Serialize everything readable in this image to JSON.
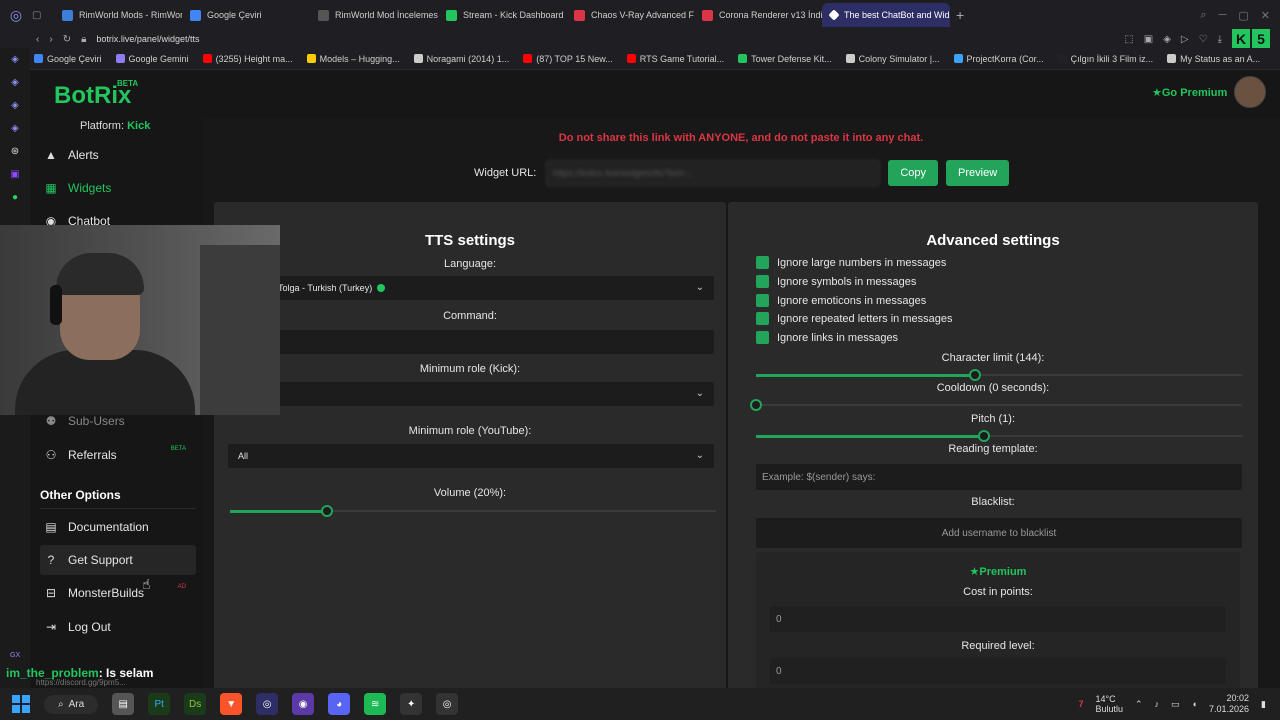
{
  "browser": {
    "tabs": [
      {
        "label": "RimWorld Mods - RimWorl",
        "color": "#3c7fd8"
      },
      {
        "label": "Google Çeviri",
        "color": "#4285f4"
      },
      {
        "label": "RimWorld Mod İncelemesi",
        "color": "#555555"
      },
      {
        "label": "Stream - Kick Dashboard",
        "color": "#22c55e"
      },
      {
        "label": "Chaos V-Ray Advanced F",
        "color": "#dc3545"
      },
      {
        "label": "Corona Renderer v13 İndi",
        "color": "#dc3545"
      },
      {
        "label": "The best ChatBot and Wid",
        "color": "#ffffff"
      }
    ],
    "active_tab_index": 6,
    "url": "botrix.live/panel/widget/tts",
    "bookmarks": [
      {
        "label": "Google Çeviri",
        "color": "#4285f4"
      },
      {
        "label": "Google Gemini",
        "color": "#8e7cf0"
      },
      {
        "label": "(3255) Height ma...",
        "color": "#ff0000"
      },
      {
        "label": "Models – Hugging...",
        "color": "#ffcc00"
      },
      {
        "label": "Noragami (2014) 1...",
        "color": "#cccccc"
      },
      {
        "label": "(87) TOP 15 New...",
        "color": "#ff0000"
      },
      {
        "label": "RTS Game Tutorial...",
        "color": "#ff0000"
      },
      {
        "label": "Tower Defense Kit...",
        "color": "#22c55e"
      },
      {
        "label": "Colony Simulator |...",
        "color": "#cccccc"
      },
      {
        "label": "ProjectKorra (Cor...",
        "color": "#3aa3ff"
      },
      {
        "label": "Çılgın İkili 3 Film iz...",
        "color": "#222222"
      },
      {
        "label": "My Status as an A...",
        "color": "#cccccc"
      }
    ]
  },
  "app": {
    "logo": "BotRix",
    "logo_badge": "BETA",
    "premium_link": "Go Premium",
    "platform_label": "Platform:",
    "platform_value": "Kick"
  },
  "sidebar": {
    "items": [
      {
        "label": "Alerts",
        "icon": "warning-icon"
      },
      {
        "label": "Widgets",
        "icon": "grid-icon"
      },
      {
        "label": "Chatbot",
        "icon": "robot-icon"
      },
      {
        "label": "Sub-Users",
        "icon": "users-icon"
      },
      {
        "label": "Referrals",
        "icon": "user-group-icon",
        "badge": "BETA"
      }
    ],
    "section_title": "Other Options",
    "other_items": [
      {
        "label": "Documentation",
        "icon": "book-icon"
      },
      {
        "label": "Get Support",
        "icon": "question-icon"
      },
      {
        "label": "MonsterBuilds",
        "icon": "laptop-icon",
        "badge": "AD"
      },
      {
        "label": "Log Out",
        "icon": "logout-icon"
      }
    ]
  },
  "widget": {
    "warning": "Do not share this link with ANYONE, and do not paste it into any chat.",
    "url_label": "Widget URL:",
    "url_value": "https://botrix.live/widgets/tts?bid=...",
    "copy_label": "Copy",
    "preview_label": "Preview"
  },
  "tts": {
    "title": "TTS settings",
    "language_label": "Language:",
    "language_value": "Tolga - Turkish (Turkey)",
    "command_label": "Command:",
    "command_value": "",
    "min_role_kick_label": "Minimum role (Kick):",
    "min_role_kick_value": "",
    "min_role_youtube_label": "Minimum role (YouTube):",
    "min_role_youtube_value": "All",
    "volume_label": "Volume (20%):",
    "volume": 0.2
  },
  "advanced": {
    "title": "Advanced settings",
    "checks": [
      {
        "label": "Ignore large numbers in messages",
        "checked": true
      },
      {
        "label": "Ignore symbols in messages",
        "checked": true
      },
      {
        "label": "Ignore emoticons in messages",
        "checked": true
      },
      {
        "label": "Ignore repeated letters in messages",
        "checked": true
      },
      {
        "label": "Ignore links in messages",
        "checked": true
      }
    ],
    "char_limit_label": "Character limit (144):",
    "char_limit": 0.45,
    "cooldown_label": "Cooldown (0 seconds):",
    "cooldown": 0,
    "pitch_label": "Pitch (1):",
    "pitch": 0.47,
    "template_label": "Reading template:",
    "template_placeholder": "Example: $(sender) says:",
    "blacklist_label": "Blacklist:",
    "blacklist_placeholder": "Add username to blacklist",
    "premium_title": "Premium",
    "cost_label": "Cost in points:",
    "cost_value": "0",
    "level_label": "Required level:",
    "level_value": "0"
  },
  "overlay": {
    "chat_user": "im_the_problem",
    "chat_message": ": Is selam",
    "status_url": "https://discord.gg/9pm5...",
    "gx_label": "GX"
  },
  "taskbar": {
    "search_label": "Ara",
    "weather_temp": "14°C",
    "weather_desc": "Bulutlu",
    "time": "20:02",
    "date": "7.01.2026",
    "weather_badge": "7"
  }
}
